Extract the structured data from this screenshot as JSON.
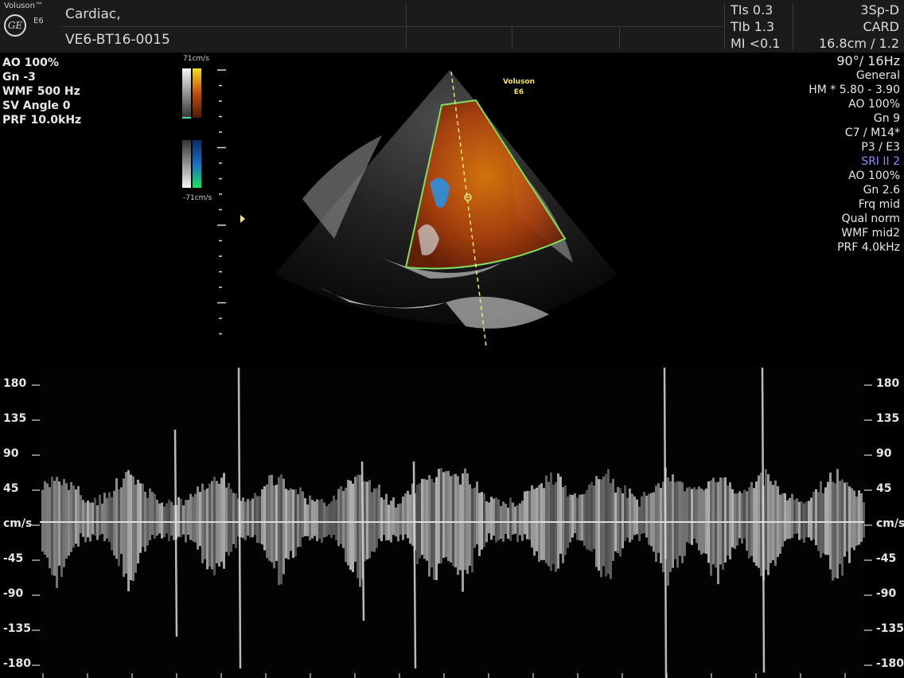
{
  "header": {
    "brand": "Voluson™",
    "model": "E6",
    "logo_text": "GE",
    "exam": "Cardiac,",
    "patient_id": "VE6-BT16-0015",
    "tis": "TIs  0.3",
    "tib": "TIb  1.3",
    "mi": "MI <0.1",
    "probe_mode": "3Sp-D",
    "preset": "CARD",
    "depth": "16.8cm / 1.2"
  },
  "left_params": [
    "AO 100%",
    "Gn  -3",
    "WMF 500 Hz",
    "SV Angle  0",
    "PRF 10.0kHz"
  ],
  "right_params": {
    "angle_rate": "90°/ 16Hz",
    "items": [
      "General",
      "HM * 5.80 - 3.90",
      "AO 100%",
      "Gn   9",
      "C7 / M14*",
      "P3 / E3"
    ],
    "sri": "SRI II 2",
    "items2": [
      "AO 100%",
      "Gn  2.6",
      "Frq mid",
      "Qual norm",
      "WMF mid2",
      "PRF  4.0kHz"
    ]
  },
  "color_bar": {
    "top": "71cm/s",
    "bottom": "-71cm/s"
  },
  "watermark": {
    "line1": "Voluson",
    "line2": "E6"
  },
  "spectral_axis": {
    "unit": "cm/s",
    "ticks": [
      "180",
      "135",
      "90",
      "45",
      "cm/s",
      "-45",
      "-90",
      "-135",
      "-180"
    ]
  },
  "colors": {
    "header_bg": "#1b1b1b",
    "roi_outline": "#7fe060",
    "cursor_line": "#e8e07a",
    "sri_text": "#8b8bff"
  }
}
